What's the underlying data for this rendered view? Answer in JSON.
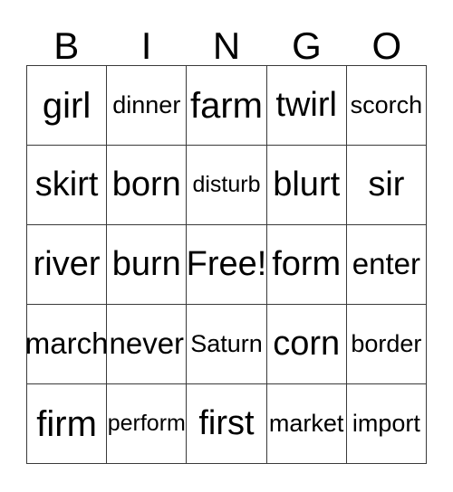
{
  "card": {
    "title": "BINGO",
    "background_color": "#ffffff",
    "border_color": "#3a3a3a",
    "text_color": "#000000"
  },
  "header": {
    "letters": [
      "B",
      "I",
      "N",
      "G",
      "O"
    ]
  },
  "grid": {
    "columns": 5,
    "rows": 5,
    "free_space": {
      "row": 2,
      "column": 2,
      "label": "Free!"
    },
    "cells": [
      [
        {
          "text": "girl",
          "size": "fs-xl"
        },
        {
          "text": "dinner",
          "size": "fs-sm"
        },
        {
          "text": "farm",
          "size": "fs-xl"
        },
        {
          "text": "twirl",
          "size": "fs-lg"
        },
        {
          "text": "scorch",
          "size": "fs-sm"
        }
      ],
      [
        {
          "text": "skirt",
          "size": "fs-lg"
        },
        {
          "text": "born",
          "size": "fs-lg"
        },
        {
          "text": "disturb",
          "size": "fs-xs"
        },
        {
          "text": "blurt",
          "size": "fs-lg"
        },
        {
          "text": "sir",
          "size": "fs-lg"
        }
      ],
      [
        {
          "text": "river",
          "size": "fs-lg"
        },
        {
          "text": "burn",
          "size": "fs-lg"
        },
        {
          "text": "Free!",
          "size": "fs-lg"
        },
        {
          "text": "form",
          "size": "fs-lg"
        },
        {
          "text": "enter",
          "size": "fs-md"
        }
      ],
      [
        {
          "text": "march",
          "size": "fs-md"
        },
        {
          "text": "never",
          "size": "fs-md"
        },
        {
          "text": "Saturn",
          "size": "fs-sm"
        },
        {
          "text": "corn",
          "size": "fs-lg"
        },
        {
          "text": "border",
          "size": "fs-sm"
        }
      ],
      [
        {
          "text": "firm",
          "size": "fs-xl"
        },
        {
          "text": "perform",
          "size": "fs-xs"
        },
        {
          "text": "first",
          "size": "fs-lg"
        },
        {
          "text": "market",
          "size": "fs-sm"
        },
        {
          "text": "import",
          "size": "fs-sm"
        }
      ]
    ]
  }
}
